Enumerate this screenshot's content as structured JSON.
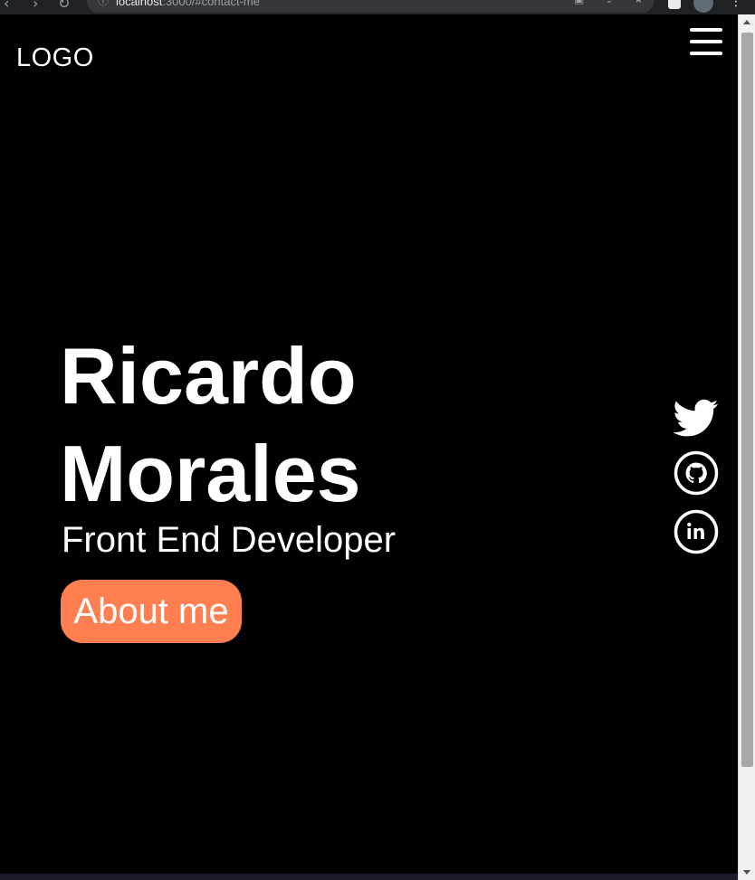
{
  "browser": {
    "url_host": "localhost",
    "url_rest": ":3000/#contact-me"
  },
  "header": {
    "logo": "LOGO",
    "menu_icon": "hamburger-menu-icon"
  },
  "hero": {
    "name_line1": "Ricardo",
    "name_line2": "Morales",
    "role": "Front End Developer",
    "cta_label": "About me"
  },
  "social": [
    {
      "name": "twitter",
      "icon": "twitter-icon"
    },
    {
      "name": "github",
      "icon": "github-icon"
    },
    {
      "name": "linkedin",
      "icon": "linkedin-icon"
    }
  ],
  "colors": {
    "background": "#000000",
    "text": "#ffffff",
    "accent": "#ff7f50"
  }
}
